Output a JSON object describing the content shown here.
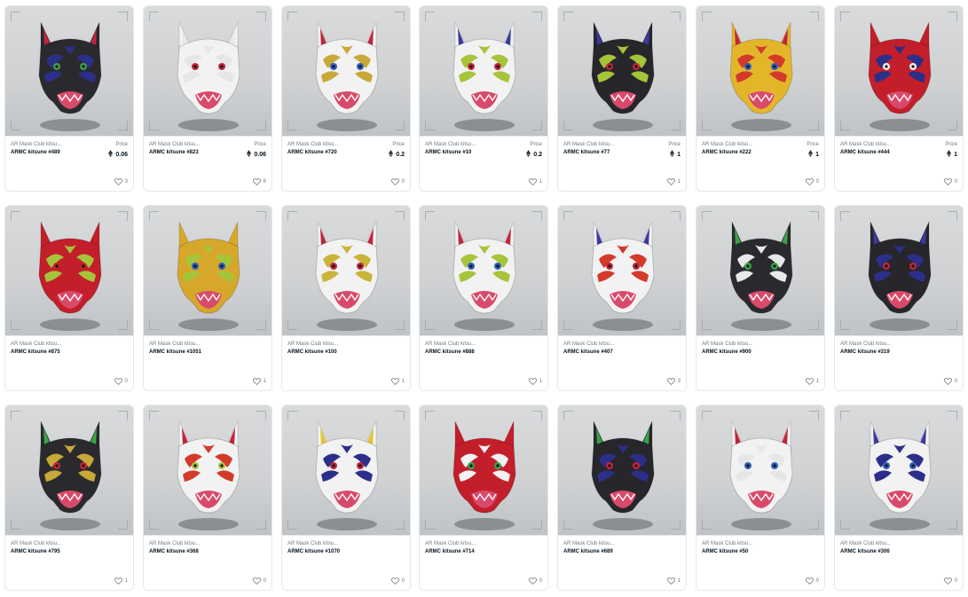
{
  "grid": {
    "cards": [
      {
        "collection": "AR Mask Club kitsu...",
        "name": "ARMC kitsune #489",
        "price_label": "Price",
        "price": "0.06",
        "likes": "3",
        "colors": {
          "base": "#2a2a2e",
          "accent": "#2c2f8a",
          "ear": "#c0263b",
          "eye": "#3aa34a",
          "mouth": "#d94a6a"
        }
      },
      {
        "collection": "AR Mask Club kitsu...",
        "name": "ARMC kitsune #823",
        "price_label": "Price",
        "price": "0.06",
        "likes": "8",
        "colors": {
          "base": "#f2f2f2",
          "accent": "#e6e6e6",
          "ear": "#e8e8e8",
          "eye": "#c0263b",
          "mouth": "#d94a6a"
        }
      },
      {
        "collection": "AR Mask Club kitsu...",
        "name": "ARMC kitsune #720",
        "price_label": "Price",
        "price": "0.2",
        "likes": "0",
        "colors": {
          "base": "#f2f2f2",
          "accent": "#c9a83a",
          "ear": "#c0263b",
          "eye": "#2f5fbf",
          "mouth": "#d94a6a"
        }
      },
      {
        "collection": "AR Mask Club kitsu...",
        "name": "ARMC kitsune #10",
        "price_label": "Price",
        "price": "0.2",
        "likes": "1",
        "colors": {
          "base": "#f2f2f2",
          "accent": "#a6c43a",
          "ear": "#3b3aa0",
          "eye": "#c0263b",
          "mouth": "#d94a6a"
        }
      },
      {
        "collection": "AR Mask Club kitsu...",
        "name": "ARMC kitsune #77",
        "price_label": "Price",
        "price": "1",
        "likes": "1",
        "colors": {
          "base": "#26262b",
          "accent": "#a6c43a",
          "ear": "#3b3aa0",
          "eye": "#c0263b",
          "mouth": "#d94a6a"
        }
      },
      {
        "collection": "AR Mask Club kitsu...",
        "name": "ARMC kitsune #222",
        "price_label": "Price",
        "price": "1",
        "likes": "0",
        "colors": {
          "base": "#e3b62a",
          "accent": "#d43a2a",
          "ear": "#c0263b",
          "eye": "#2f5fbf",
          "mouth": "#d94a6a"
        }
      },
      {
        "collection": "AR Mask Club kitsu...",
        "name": "ARMC kitsune #444",
        "price_label": "Price",
        "price": "1",
        "likes": "0",
        "colors": {
          "base": "#c21f2b",
          "accent": "#2c2f8a",
          "ear": "#c21f2b",
          "eye": "#f2f2f2",
          "mouth": "#d94a6a"
        }
      },
      {
        "collection": "AR Mask Club kitsu...",
        "name": "ARMC kitsune #875",
        "likes": "0",
        "colors": {
          "base": "#c21f2b",
          "accent": "#a6c43a",
          "ear": "#c21f2b",
          "eye": "#c21f2b",
          "mouth": "#d94a6a"
        }
      },
      {
        "collection": "AR Mask Club kitsu...",
        "name": "ARMC kitsune #1051",
        "likes": "1",
        "colors": {
          "base": "#d6a72a",
          "accent": "#a6c43a",
          "ear": "#d6a72a",
          "eye": "#2f5fbf",
          "mouth": "#d94a6a"
        }
      },
      {
        "collection": "AR Mask Club kitsu...",
        "name": "ARMC kitsune #100",
        "likes": "1",
        "colors": {
          "base": "#f2f2f2",
          "accent": "#c9b43a",
          "ear": "#c0263b",
          "eye": "#c0263b",
          "mouth": "#d94a6a"
        }
      },
      {
        "collection": "AR Mask Club kitsu...",
        "name": "ARMC kitsune #888",
        "likes": "1",
        "colors": {
          "base": "#f2f2f2",
          "accent": "#a6c43a",
          "ear": "#c0263b",
          "eye": "#2f5fbf",
          "mouth": "#d94a6a"
        }
      },
      {
        "collection": "AR Mask Club kitsu...",
        "name": "ARMC kitsune #407",
        "likes": "3",
        "colors": {
          "base": "#f2f2f2",
          "accent": "#d43a2a",
          "ear": "#3b3aa0",
          "eye": "#c0263b",
          "mouth": "#d94a6a"
        }
      },
      {
        "collection": "AR Mask Club kitsu...",
        "name": "ARMC kitsune #900",
        "likes": "1",
        "colors": {
          "base": "#2a2a2e",
          "accent": "#e8e8e8",
          "ear": "#3aa34a",
          "eye": "#3aa34a",
          "mouth": "#d94a6a"
        }
      },
      {
        "collection": "AR Mask Club kitsu...",
        "name": "ARMC kitsune #319",
        "likes": "0",
        "colors": {
          "base": "#26262b",
          "accent": "#2c2f8a",
          "ear": "#3b3aa0",
          "eye": "#c0263b",
          "mouth": "#d94a6a"
        }
      },
      {
        "collection": "AR Mask Club kitsu...",
        "name": "ARMC kitsune #795",
        "likes": "1",
        "colors": {
          "base": "#2a2a2e",
          "accent": "#c9a83a",
          "ear": "#3aa34a",
          "eye": "#c0263b",
          "mouth": "#d94a6a"
        }
      },
      {
        "collection": "AR Mask Club kitsu...",
        "name": "ARMC kitsune #368",
        "likes": "0",
        "colors": {
          "base": "#f2f2f2",
          "accent": "#d43a2a",
          "ear": "#c0263b",
          "eye": "#a6c43a",
          "mouth": "#d94a6a"
        }
      },
      {
        "collection": "AR Mask Club kitsu...",
        "name": "ARMC kitsune #1070",
        "likes": "0",
        "colors": {
          "base": "#f2f2f2",
          "accent": "#2c2f8a",
          "ear": "#e3c52a",
          "eye": "#c0263b",
          "mouth": "#d94a6a"
        }
      },
      {
        "collection": "AR Mask Club kitsu...",
        "name": "ARMC kitsune #714",
        "likes": "0",
        "colors": {
          "base": "#c21f2b",
          "accent": "#f2f2f2",
          "ear": "#c21f2b",
          "eye": "#3aa34a",
          "mouth": "#d94a6a"
        }
      },
      {
        "collection": "AR Mask Club kitsu...",
        "name": "ARMC kitsune #689",
        "likes": "1",
        "colors": {
          "base": "#26262b",
          "accent": "#2c2f8a",
          "ear": "#3aa34a",
          "eye": "#c0263b",
          "mouth": "#d94a6a"
        }
      },
      {
        "collection": "AR Mask Club kitsu...",
        "name": "ARMC kitsune #50",
        "likes": "0",
        "colors": {
          "base": "#f2f2f2",
          "accent": "#e6e6e6",
          "ear": "#c0263b",
          "eye": "#2f5fbf",
          "mouth": "#d94a6a"
        }
      },
      {
        "collection": "AR Mask Club kitsu...",
        "name": "ARMC kitsune #306",
        "likes": "0",
        "colors": {
          "base": "#f2f2f2",
          "accent": "#2c2f8a",
          "ear": "#3b3aa0",
          "eye": "#2f5fbf",
          "mouth": "#d94a6a"
        }
      }
    ]
  },
  "icons": {
    "heart": "heart-icon",
    "eth": "ethereum-icon"
  }
}
